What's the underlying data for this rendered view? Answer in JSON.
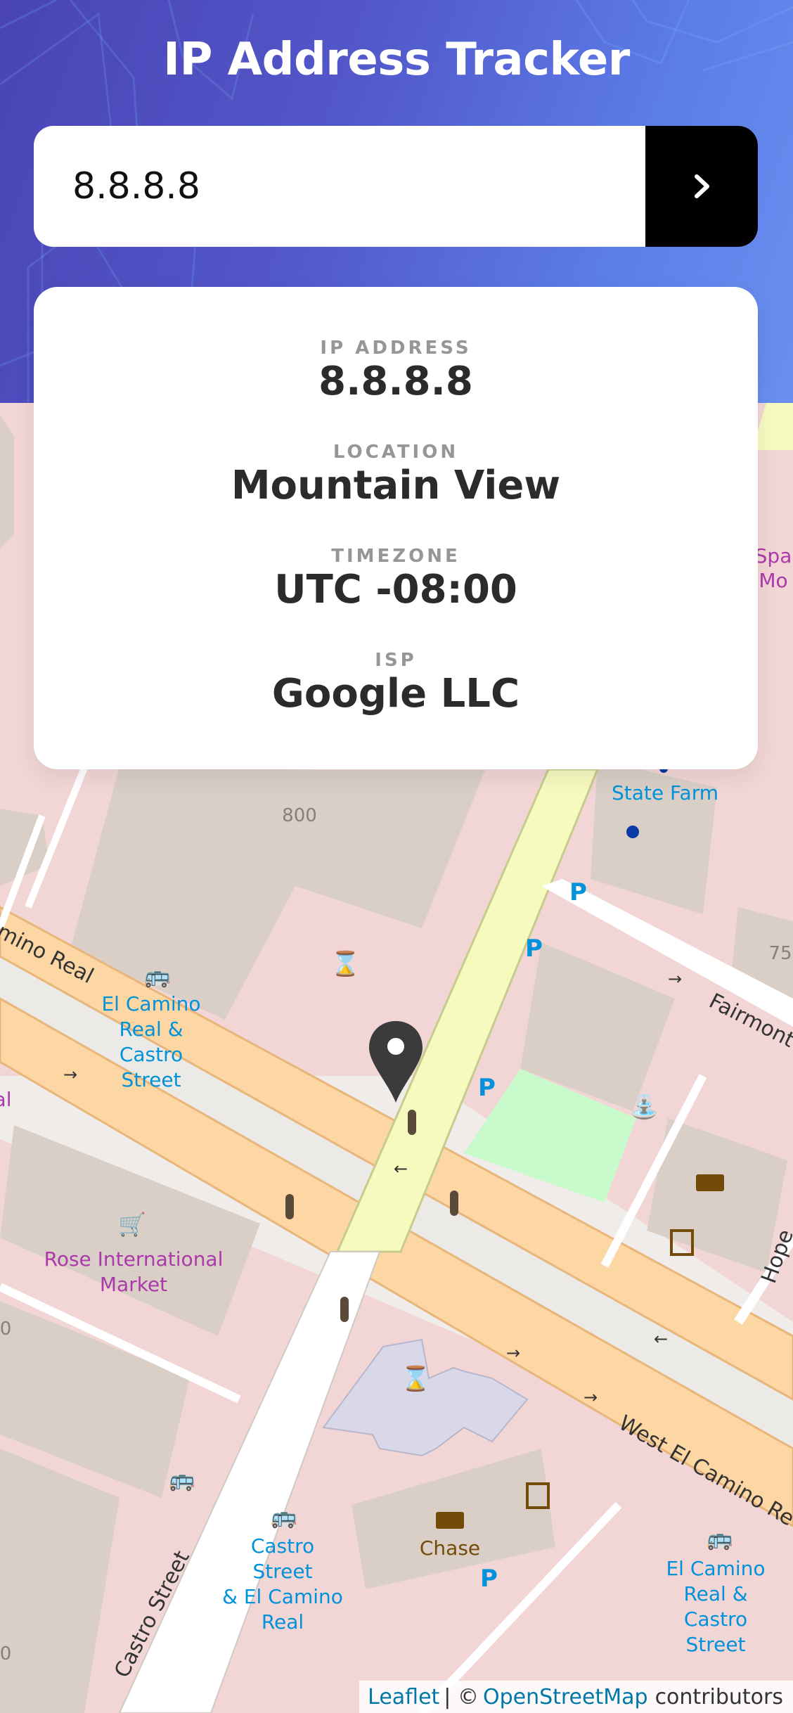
{
  "header": {
    "title": "IP Address Tracker",
    "background_colors": [
      "#4a44b5",
      "#6a8ff0"
    ]
  },
  "search": {
    "value": "8.8.8.8",
    "placeholder": "",
    "submit_icon": "chevron-right-icon"
  },
  "info": {
    "ip": {
      "label": "IP ADDRESS",
      "value": "8.8.8.8"
    },
    "location": {
      "label": "LOCATION",
      "value": "Mountain View"
    },
    "timezone": {
      "label": "TIMEZONE",
      "value": "UTC -08:00"
    },
    "isp": {
      "label": "ISP",
      "value": "Google LLC"
    }
  },
  "map": {
    "streets": {
      "camino_real_left": "mino Real",
      "west_el_camino": "West El Camino Re",
      "castro": "Castro Street",
      "fairmont": "Fairmont",
      "hope": "Hope"
    },
    "pois": {
      "bus1_line1": "El Camino",
      "bus1_line2": "Real &",
      "bus1_line3": "Castro",
      "bus1_line4": "Street",
      "rose_line1": "Rose International",
      "rose_line2": "Market",
      "state_farm": "State Farm",
      "chase": "Chase",
      "bus2_line1": "Castro",
      "bus2_line2": "Street",
      "bus2_line3": "& El Camino",
      "bus2_line4": "Real",
      "bus3_line1": "El Camino",
      "bus3_line2": "Real &",
      "bus3_line3": "Castro",
      "bus3_line4": "Street",
      "spa_line1": "Spa",
      "spa_line2": "Mo",
      "number_800": "800",
      "number_75": "75",
      "edge_al": "al",
      "edge_0a": "0",
      "edge_0b": "0"
    },
    "marker_icon": "map-pin-icon",
    "colors": {
      "block": "#f2d6d6",
      "building": "#d9cfc7",
      "primary_road": "#fcd6a3",
      "secondary_road": "#f7fabf",
      "park": "#c8facc",
      "poi_blue": "#0092da",
      "poi_purple": "#ac39ac",
      "poi_brown": "#734a08"
    }
  },
  "attribution": {
    "leaflet": "Leaflet",
    "separator": "| ©",
    "osm": "OpenStreetMap",
    "suffix": "contributors"
  }
}
